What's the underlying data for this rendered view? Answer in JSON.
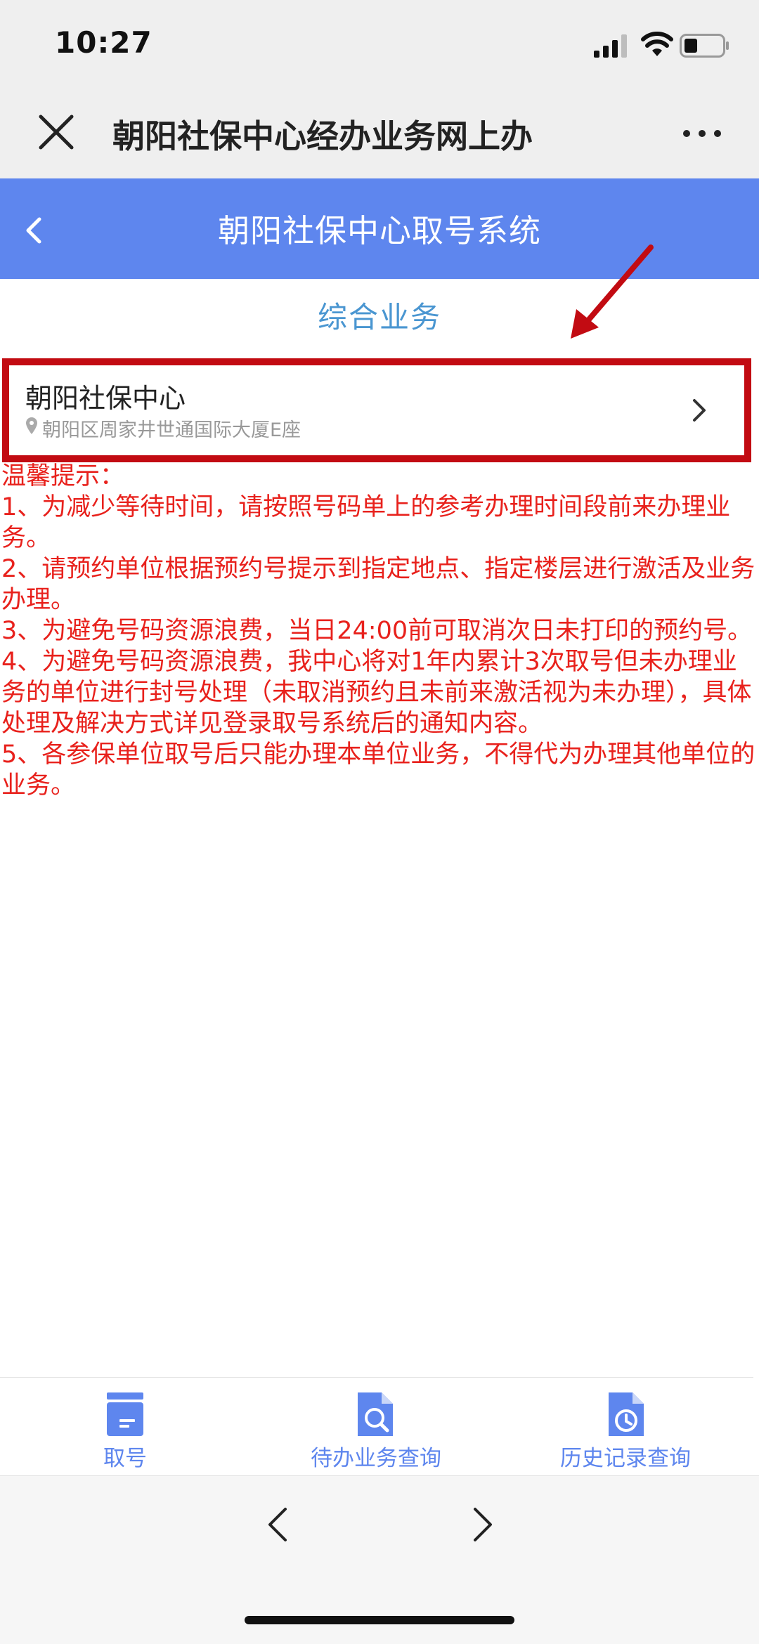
{
  "status_bar": {
    "time": "10:27"
  },
  "browser_header": {
    "title": "朝阳社保中心经办业务网上办"
  },
  "app_header": {
    "title": "朝阳社保中心取号系统"
  },
  "section": {
    "title": "综合业务"
  },
  "location_card": {
    "name": "朝阳社保中心",
    "address": "朝阳区周家井世通国际大厦E座"
  },
  "notice": {
    "heading": "温馨提示：",
    "items": [
      "1、为减少等待时间，请按照号码单上的参考办理时间段前来办理业务。",
      "2、请预约单位根据预约号提示到指定地点、指定楼层进行激活及业务办理。",
      "3、为避免号码资源浪费，当日24:00前可取消次日未打印的预约号。",
      "4、为避免号码资源浪费，我中心将对1年内累计3次取号但未办理业务的单位进行封号处理（未取消预约且未前来激活视为未办理），具体处理及解决方式详见登录取号系统后的通知内容。",
      "5、各参保单位取号后只能办理本单位业务，不得代为办理其他单位的业务。"
    ]
  },
  "tabs": [
    {
      "label": "取号",
      "icon": "ticket-icon"
    },
    {
      "label": "待办业务查询",
      "icon": "document-search-icon"
    },
    {
      "label": "历史记录查询",
      "icon": "document-clock-icon"
    }
  ],
  "colors": {
    "header_blue": "#5e86ee",
    "section_blue": "#4a96d1",
    "notice_red": "#e8211c",
    "highlight_red": "#c20b12"
  }
}
